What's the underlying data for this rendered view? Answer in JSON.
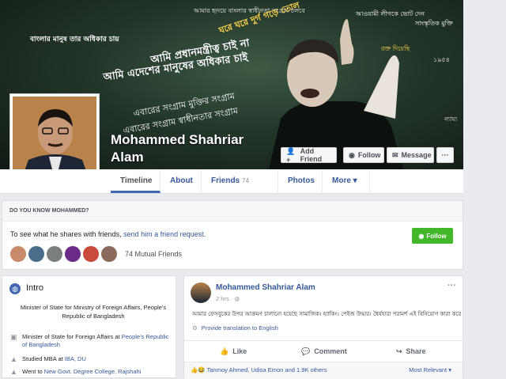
{
  "cover": {
    "texts": [
      "আমার হৃদয়ে বাংলার স্বাধীনতা সংগ্রাম চলবে",
      "বাংলার মানুষ তার অধিকার চায়",
      "আমি প্রধানমন্ত্রীত্ব চাই না",
      "আমি এদেশের মানুষের অধিকার চাই",
      "এবারের সংগ্রাম মুক্তির সংগ্রাম",
      "এবারের সংগ্রাম স্বাধীনতার সংগ্রাম",
      "আওয়ামী লীগকে ভোট দেন",
      "সাংস্কৃতিক মুক্তি",
      "রক্ত দিয়েছি",
      "১৯৫৪",
      "ঘরে ঘরে দুর্গ গড়ে তোল",
      "ন্যায্য"
    ]
  },
  "profile": {
    "name": "Mohammed Shahriar Alam"
  },
  "actions": {
    "add_friend": "Add Friend",
    "follow": "Follow",
    "message": "Message",
    "more": "···"
  },
  "tabs": [
    {
      "label": "Timeline"
    },
    {
      "label": "About"
    },
    {
      "label": "Friends",
      "count": "74 Mutual"
    },
    {
      "label": "Photos"
    },
    {
      "label": "More ▾"
    }
  ],
  "know": {
    "header": "DO YOU KNOW MOHAMMED?",
    "text_prefix": "To see what he shares with friends,",
    "link": "send him a friend request",
    "text_suffix": ".",
    "follow_label": "Follow",
    "mutual": "74 Mutual Friends"
  },
  "intro": {
    "title": "Intro",
    "bio": "Minister of State for Ministry of Foreign Affairs, People's Republic of Bangladesh",
    "rows": [
      {
        "pre": "Minister of State for Foreign Affairs at ",
        "link": "People's Republic of Bangladesh",
        "icon": "briefcase-icon"
      },
      {
        "pre": "Studied MBA at ",
        "link": "IBA, DU",
        "icon": "graduation-cap-icon"
      },
      {
        "pre": "Went to ",
        "link": "New Govt. Degree College, Rajshahi",
        "icon": "graduation-cap-icon"
      }
    ]
  },
  "post": {
    "author": "Mohammed Shahriar Alam",
    "time": "2 hrs · ",
    "body": "আমার ফেসবুকের উপর আক্রমণ চালানো হয়েছে সামাজিক। হ্যাকিং। পেইজ উদ্ধার। ধৈর্যহারা পরামর্শ এই বিনিয়োগ কারা করেছে।",
    "translate": "Provide translation to English",
    "like": "Like",
    "comment": "Comment",
    "share": "Share",
    "reactions": "Tanmoy Ahmed, Udisa Emon and 1.9K others",
    "sort": "Most Relevant ▾"
  },
  "colors": {
    "link": "#365899",
    "green": "#42b72a",
    "cover_dark": "#1b2a20"
  }
}
